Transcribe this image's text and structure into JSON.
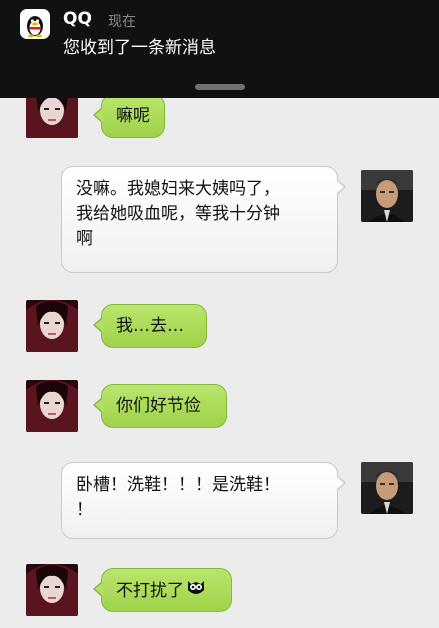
{
  "notification": {
    "app_name": "QQ",
    "time": "现在",
    "message": "您收到了一条新消息",
    "icon": "qq-penguin-icon"
  },
  "messages": [
    {
      "side": "left",
      "text": "嘛呢",
      "avatar": "avatar-anime-girl"
    },
    {
      "side": "right",
      "lines": [
        "没嘛。我媳妇来大姨吗了，",
        "我给她吸血呢，等我十分钟",
        "啊"
      ],
      "avatar": "avatar-man-photo"
    },
    {
      "side": "left",
      "text": "我…去…",
      "avatar": "avatar-anime-girl"
    },
    {
      "side": "left",
      "text": "你们好节俭",
      "avatar": "avatar-anime-girl"
    },
    {
      "side": "right",
      "lines": [
        "卧槽！洗鞋！！！是洗鞋！",
        "！"
      ],
      "avatar": "avatar-man-photo"
    },
    {
      "side": "left",
      "text": "不打扰了",
      "emoji": "owl-emoji-icon",
      "avatar": "avatar-anime-girl"
    }
  ],
  "colors": {
    "green_bubble": "#a8d957",
    "white_bubble": "#f7f7f7",
    "background": "#ececec",
    "banner": "#111111"
  }
}
